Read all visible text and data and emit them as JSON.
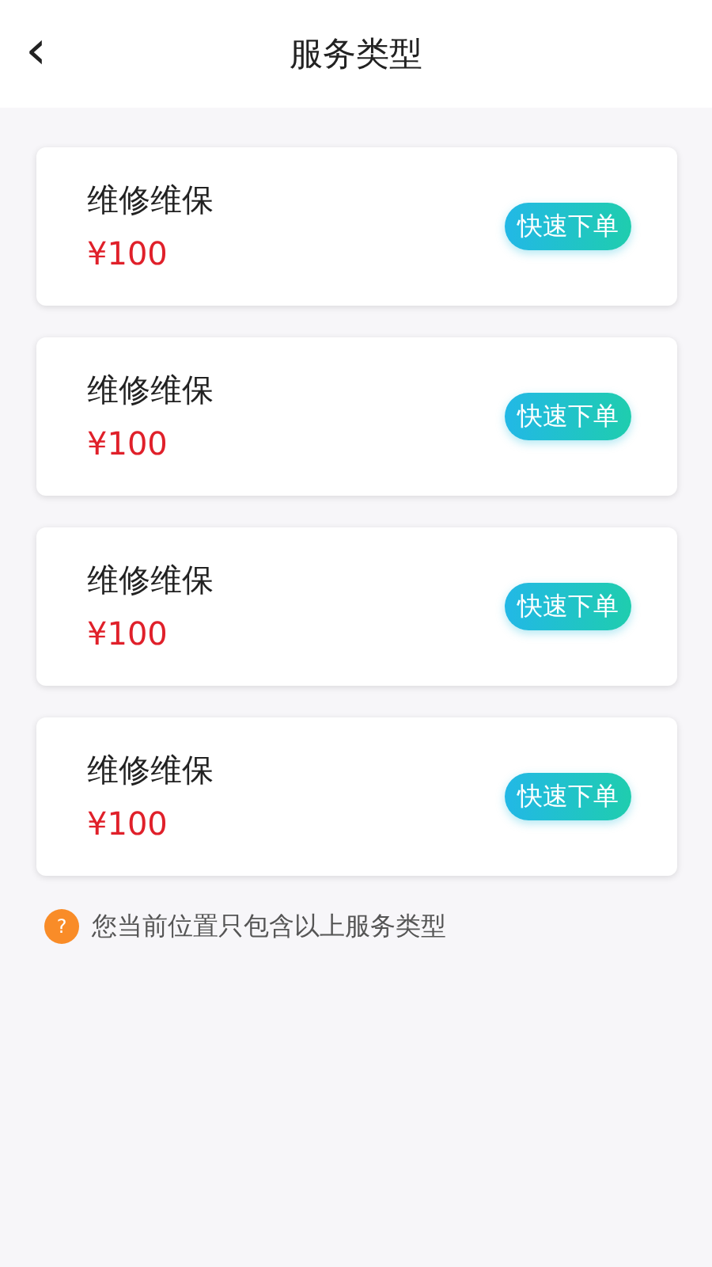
{
  "header": {
    "back_glyph": "‹",
    "title": "服务类型"
  },
  "services": [
    {
      "name": "维修维保",
      "price": "¥100",
      "button": "快速下单"
    },
    {
      "name": "维修维保",
      "price": "¥100",
      "button": "快速下单"
    },
    {
      "name": "维修维保",
      "price": "¥100",
      "button": "快速下单"
    },
    {
      "name": "维修维保",
      "price": "¥100",
      "button": "快速下单"
    }
  ],
  "note": {
    "icon_glyph": "?",
    "text": "您当前位置只包含以上服务类型"
  }
}
